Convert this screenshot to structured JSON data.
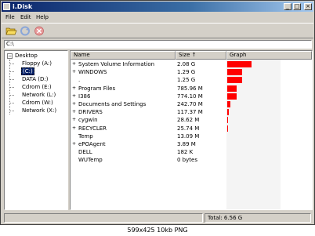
{
  "window": {
    "title": "i.Disk",
    "minimize": "_",
    "maximize": "□",
    "close": "×"
  },
  "menu": {
    "file": "File",
    "edit": "Edit",
    "help": "Help"
  },
  "toolbar": {
    "open_icon": "folder-open-icon",
    "refresh_icon": "refresh-icon",
    "stop_icon": "stop-icon"
  },
  "path": {
    "value": "C:\\"
  },
  "tree": {
    "root": "Desktop",
    "root_expander": "−",
    "items": [
      {
        "label": "Floppy (A:)"
      },
      {
        "label": "(C:)"
      },
      {
        "label": "DATA (D:)"
      },
      {
        "label": "Cdrom (E:)"
      },
      {
        "label": "Network (L:)"
      },
      {
        "label": "Cdrom (W:)"
      },
      {
        "label": "Network (X:)"
      }
    ]
  },
  "list": {
    "columns": {
      "name": "Name",
      "size": "Size ↑",
      "graph": "Graph"
    },
    "rows": [
      {
        "expander": "+",
        "name": "System Volume Information",
        "size": "2.08 G",
        "graph_fraction": 0.48
      },
      {
        "expander": "+",
        "name": "WINDOWS",
        "size": "1.29 G",
        "graph_fraction": 0.3
      },
      {
        "expander": "",
        "name": ".",
        "size": "1.25 G",
        "graph_fraction": 0.29
      },
      {
        "expander": "+",
        "name": "Program Files",
        "size": "785.96 M",
        "graph_fraction": 0.18
      },
      {
        "expander": "+",
        "name": "I386",
        "size": "774.10 M",
        "graph_fraction": 0.18
      },
      {
        "expander": "+",
        "name": "Documents and Settings",
        "size": "242.70 M",
        "graph_fraction": 0.06
      },
      {
        "expander": "+",
        "name": "DRIVERS",
        "size": "117.37 M",
        "graph_fraction": 0.03
      },
      {
        "expander": "+",
        "name": "cygwin",
        "size": "28.62 M",
        "graph_fraction": 0.01
      },
      {
        "expander": "+",
        "name": "RECYCLER",
        "size": "25.74 M",
        "graph_fraction": 0.01
      },
      {
        "expander": "",
        "name": "Temp",
        "size": "13.09 M",
        "graph_fraction": 0.0
      },
      {
        "expander": "+",
        "name": "ePOAgent",
        "size": "3.89 M",
        "graph_fraction": 0.0
      },
      {
        "expander": "",
        "name": "DELL",
        "size": "182 K",
        "graph_fraction": 0.0
      },
      {
        "expander": "",
        "name": "WUTemp",
        "size": "0 bytes",
        "graph_fraction": 0.0
      }
    ]
  },
  "status": {
    "total": "Total: 6.56 G"
  },
  "caption": "599x425  10kb  PNG",
  "colors": {
    "bar": "#ff0000",
    "title_start": "#0a246a",
    "title_end": "#a6caf0"
  }
}
